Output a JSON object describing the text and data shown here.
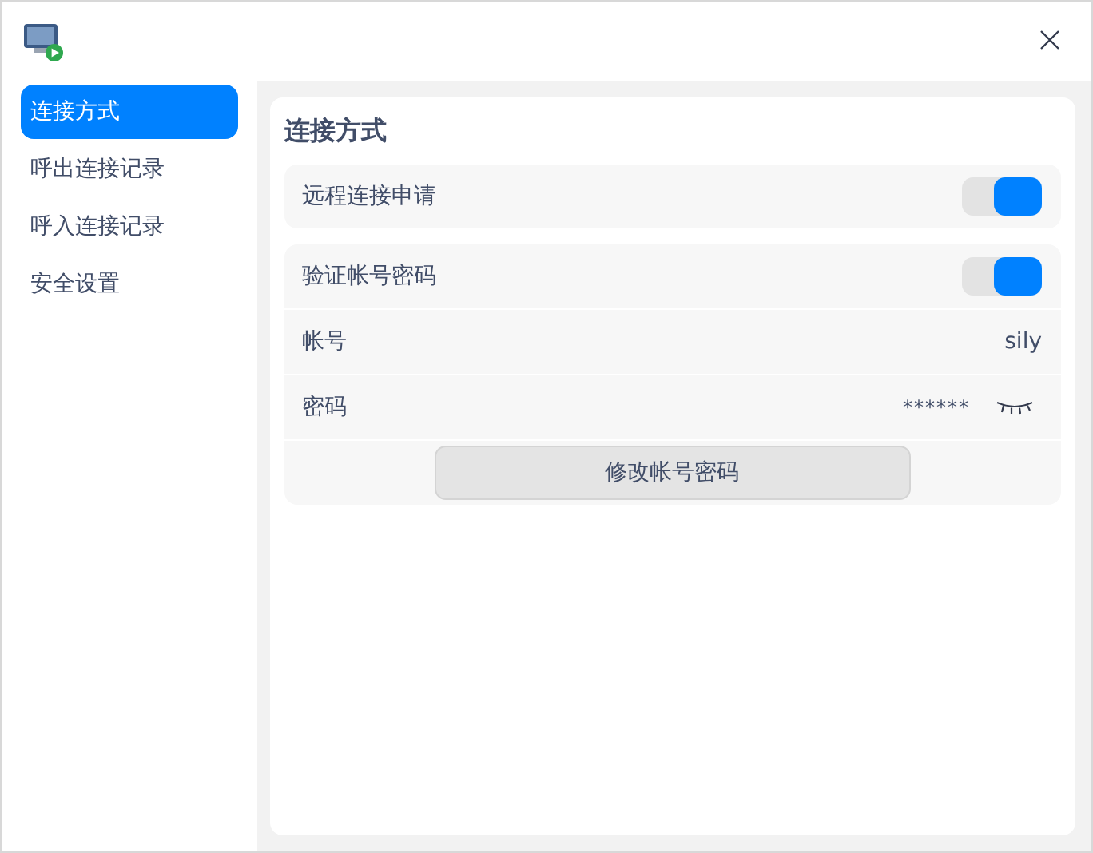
{
  "sidebar": {
    "items": [
      {
        "label": "连接方式",
        "selected": true
      },
      {
        "label": "呼出连接记录",
        "selected": false
      },
      {
        "label": "呼入连接记录",
        "selected": false
      },
      {
        "label": "安全设置",
        "selected": false
      }
    ]
  },
  "section": {
    "title": "连接方式",
    "groups": [
      {
        "rows": [
          {
            "kind": "toggle",
            "label": "远程连接申请",
            "on": true
          }
        ]
      },
      {
        "rows": [
          {
            "kind": "toggle",
            "label": "验证帐号密码",
            "on": true
          },
          {
            "kind": "value",
            "label": "帐号",
            "value": "sily"
          },
          {
            "kind": "password",
            "label": "密码",
            "value": "******"
          },
          {
            "kind": "button",
            "label": "修改帐号密码"
          }
        ]
      }
    ]
  }
}
